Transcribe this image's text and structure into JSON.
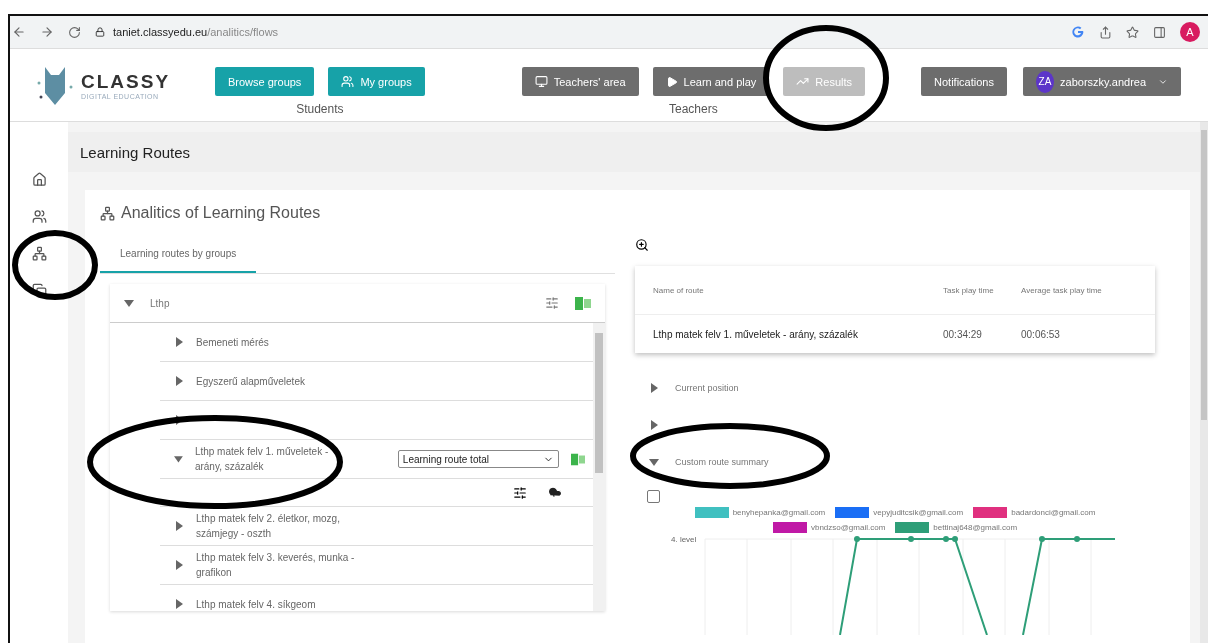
{
  "browser": {
    "url_host": "taniet.classyedu.eu",
    "url_path": "/analitics/flows",
    "profile_initial": "A"
  },
  "logo": {
    "name": "CLASSY",
    "tagline": "DIGITAL EDUCATION"
  },
  "nav_groups": [
    {
      "label": "Students",
      "buttons": [
        {
          "label": "Browse groups",
          "disabled": false
        },
        {
          "label": "My groups",
          "disabled": false
        }
      ]
    },
    {
      "label": "Teachers",
      "buttons": [
        {
          "label": "Teachers' area",
          "disabled": false
        },
        {
          "label": "Learn and play",
          "disabled": false
        },
        {
          "label": "Results",
          "disabled": true
        }
      ]
    }
  ],
  "notifications": "Notifications",
  "user": {
    "initials": "ZA",
    "name": "zaborszky.andrea"
  },
  "page_title": "Learning Routes",
  "card": {
    "title": "Analitics of Learning Routes",
    "tabs": [
      {
        "label": "Learning routes by groups",
        "selected": true
      }
    ],
    "tree": {
      "label": "Lthp",
      "expanded": true,
      "children": [
        {
          "label": "Bemeneti mérés",
          "expanded": false
        },
        {
          "label": "Egyszerű alapműveletek",
          "expanded": false
        },
        {
          "expanded": false
        },
        {
          "label": "Lthp matek felv 1. műveletek - arány, százalék",
          "expanded": true,
          "select": "Learning route total"
        },
        {
          "label": "Lthp matek felv 2. életkor, mozg, számjegy - oszth",
          "expanded": false
        },
        {
          "label": "Lthp matek felv 3. keverés, munka - grafikon",
          "expanded": false
        },
        {
          "label": "Lthp matek felv 4. síkgeom",
          "expanded": false
        }
      ]
    },
    "report": {
      "table": {
        "columns": [
          "Name of route",
          "Task play time",
          "Average task play time"
        ],
        "rows": [
          [
            "Lthp matek felv 1. műveletek - arány, százalék",
            "00:34:29",
            "00:06:53"
          ]
        ]
      },
      "sections": [
        {
          "label": "Current position",
          "expanded": false
        },
        {
          "expanded": false
        },
        {
          "label": "Custom route summary",
          "expanded": true
        }
      ],
      "checkbox": {
        "checked": false
      },
      "legend": [
        {
          "label": "benyhepanka@gmail.com",
          "color": "#40c0c0"
        },
        {
          "label": "vepyjuditcsik@gmail.com",
          "color": "#1a6ef5"
        },
        {
          "label": "badardonci@gmail.com",
          "color": "#e0307f"
        },
        {
          "label": "vbndzso@gmail.com",
          "color": "#c019a6"
        },
        {
          "label": "bettinaj648@gmail.com",
          "color": "#2e9e78"
        }
      ],
      "y_label": "4. level"
    }
  }
}
